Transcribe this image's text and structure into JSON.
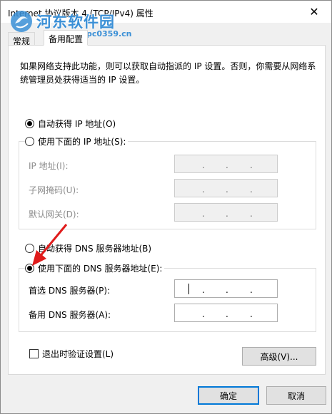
{
  "window": {
    "title": "Internet 协议版本 4 (TCP/IPv4) 属性",
    "close_glyph": "✕"
  },
  "watermark": {
    "name": "河东软件园",
    "url": "www.pc0359.cn"
  },
  "tabs": [
    {
      "label": "常规"
    },
    {
      "label": "备用配置"
    }
  ],
  "description": "如果网络支持此功能，则可以获取自动指派的 IP 设置。否则，你需要从网络系统管理员处获得适当的 IP 设置。",
  "ip_section": {
    "auto_label": "自动获得 IP 地址(O)",
    "manual_label": "使用下面的 IP 地址(S):",
    "selected": "auto",
    "fields": [
      {
        "label": "IP 地址(I):",
        "value": ""
      },
      {
        "label": "子网掩码(U):",
        "value": ""
      },
      {
        "label": "默认网关(D):",
        "value": ""
      }
    ]
  },
  "dns_section": {
    "auto_label": "自动获得 DNS 服务器地址(B)",
    "manual_label": "使用下面的 DNS 服务器地址(E):",
    "selected": "manual",
    "fields": [
      {
        "label": "首选 DNS 服务器(P):",
        "value": ""
      },
      {
        "label": "备用 DNS 服务器(A):",
        "value": ""
      }
    ]
  },
  "validate_label": "退出时验证设置(L)",
  "advanced_label": "高级(V)...",
  "ok_label": "确定",
  "cancel_label": "取消",
  "ip_separator": "."
}
